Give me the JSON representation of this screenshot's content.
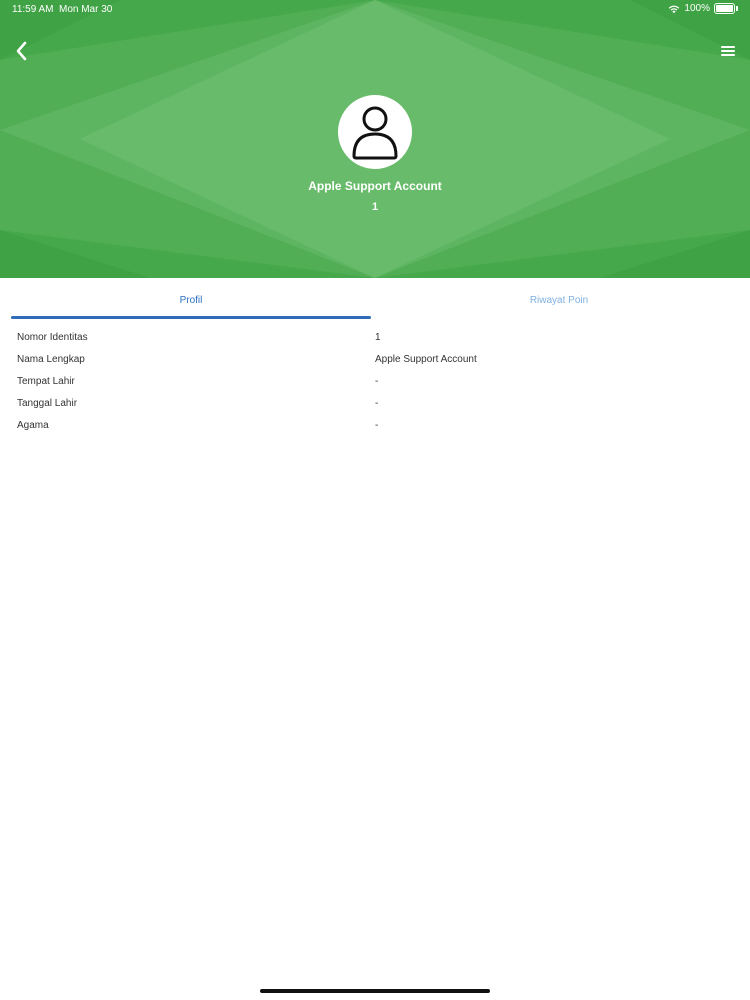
{
  "status_bar": {
    "time": "11:59 AM",
    "date": "Mon Mar 30",
    "battery": "100%"
  },
  "header": {
    "background_color": "#45a84a",
    "back_icon": "chevron-left-icon",
    "menu_icon": "hamburger-menu-icon"
  },
  "profile": {
    "avatar_icon": "user-outline-icon",
    "name": "Apple Support Account",
    "id": "1"
  },
  "tabs": [
    {
      "label": "Profil",
      "active": true
    },
    {
      "label": "Riwayat Poin",
      "active": false
    }
  ],
  "info": [
    {
      "label": "Nomor Identitas",
      "value": "1"
    },
    {
      "label": "Nama Lengkap",
      "value": "Apple Support Account"
    },
    {
      "label": "Tempat Lahir",
      "value": "-"
    },
    {
      "label": "Tanggal Lahir",
      "value": "-"
    },
    {
      "label": "Agama",
      "value": "-"
    }
  ],
  "colors": {
    "accent": "#2f6db8",
    "header_green": "#45a84a"
  }
}
